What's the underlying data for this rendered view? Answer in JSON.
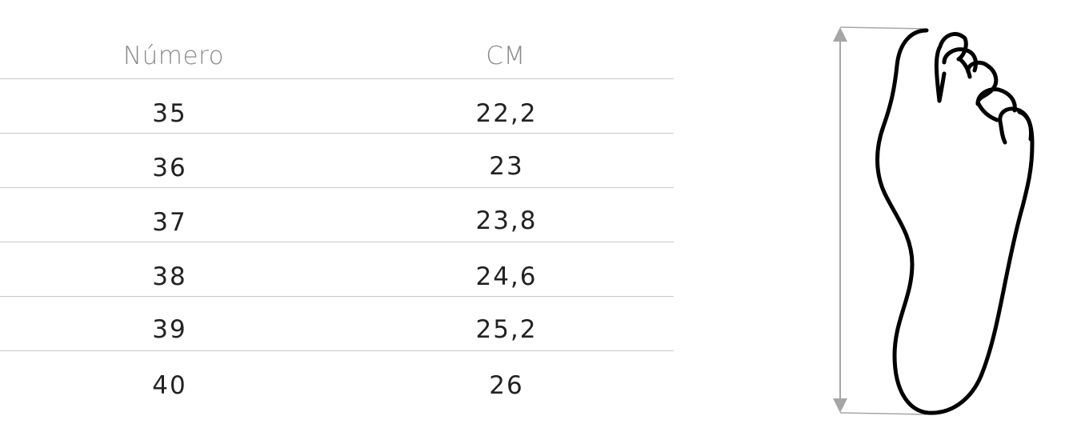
{
  "table": {
    "header_number": "Número",
    "header_cm": "CM",
    "rows": [
      {
        "number": "35",
        "cm": "22,2"
      },
      {
        "number": "36",
        "cm": "23"
      },
      {
        "number": "37",
        "cm": "23,8"
      },
      {
        "number": "38",
        "cm": "24,6"
      },
      {
        "number": "39",
        "cm": "25,2"
      },
      {
        "number": "40",
        "cm": "26"
      }
    ]
  },
  "colors": {
    "header_text": "#8a8a8a",
    "body_text": "#222222",
    "rule": "#c9c9c9",
    "foot_outline": "#000000",
    "measure_arrow": "#a6a6a6"
  },
  "icons": {
    "foot": "foot-outline-icon",
    "length_arrow": "double-arrow-vertical-icon"
  }
}
